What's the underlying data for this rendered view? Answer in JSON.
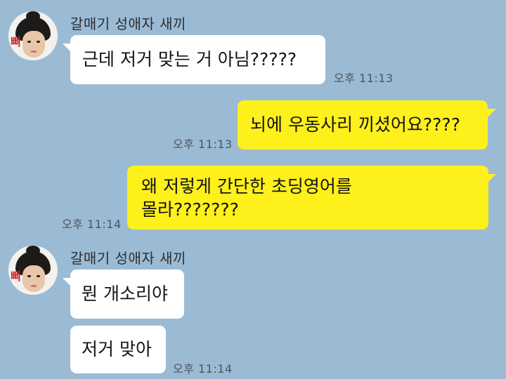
{
  "messages": [
    {
      "sender": "갈매기 성애자 새끼",
      "text": "근데 저거 맞는 거 아님?????",
      "time": "오후 11:13"
    },
    {
      "text": "뇌에 우동사리 끼셨어요????",
      "time": "오후 11:13"
    },
    {
      "text_lines": [
        "왜 저렇게 간단한 초딩영어를",
        "몰라???????"
      ],
      "time": "오후 11:14"
    },
    {
      "sender": "갈매기 성애자 새끼",
      "text": "뭔 개소리야"
    },
    {
      "text": "저거 맞아",
      "time": "오후 11:14"
    }
  ],
  "avatar_stamp": "삐",
  "colors": {
    "background": "#9bbbd4",
    "incoming_bubble": "#ffffff",
    "outgoing_bubble": "#fef01b"
  }
}
